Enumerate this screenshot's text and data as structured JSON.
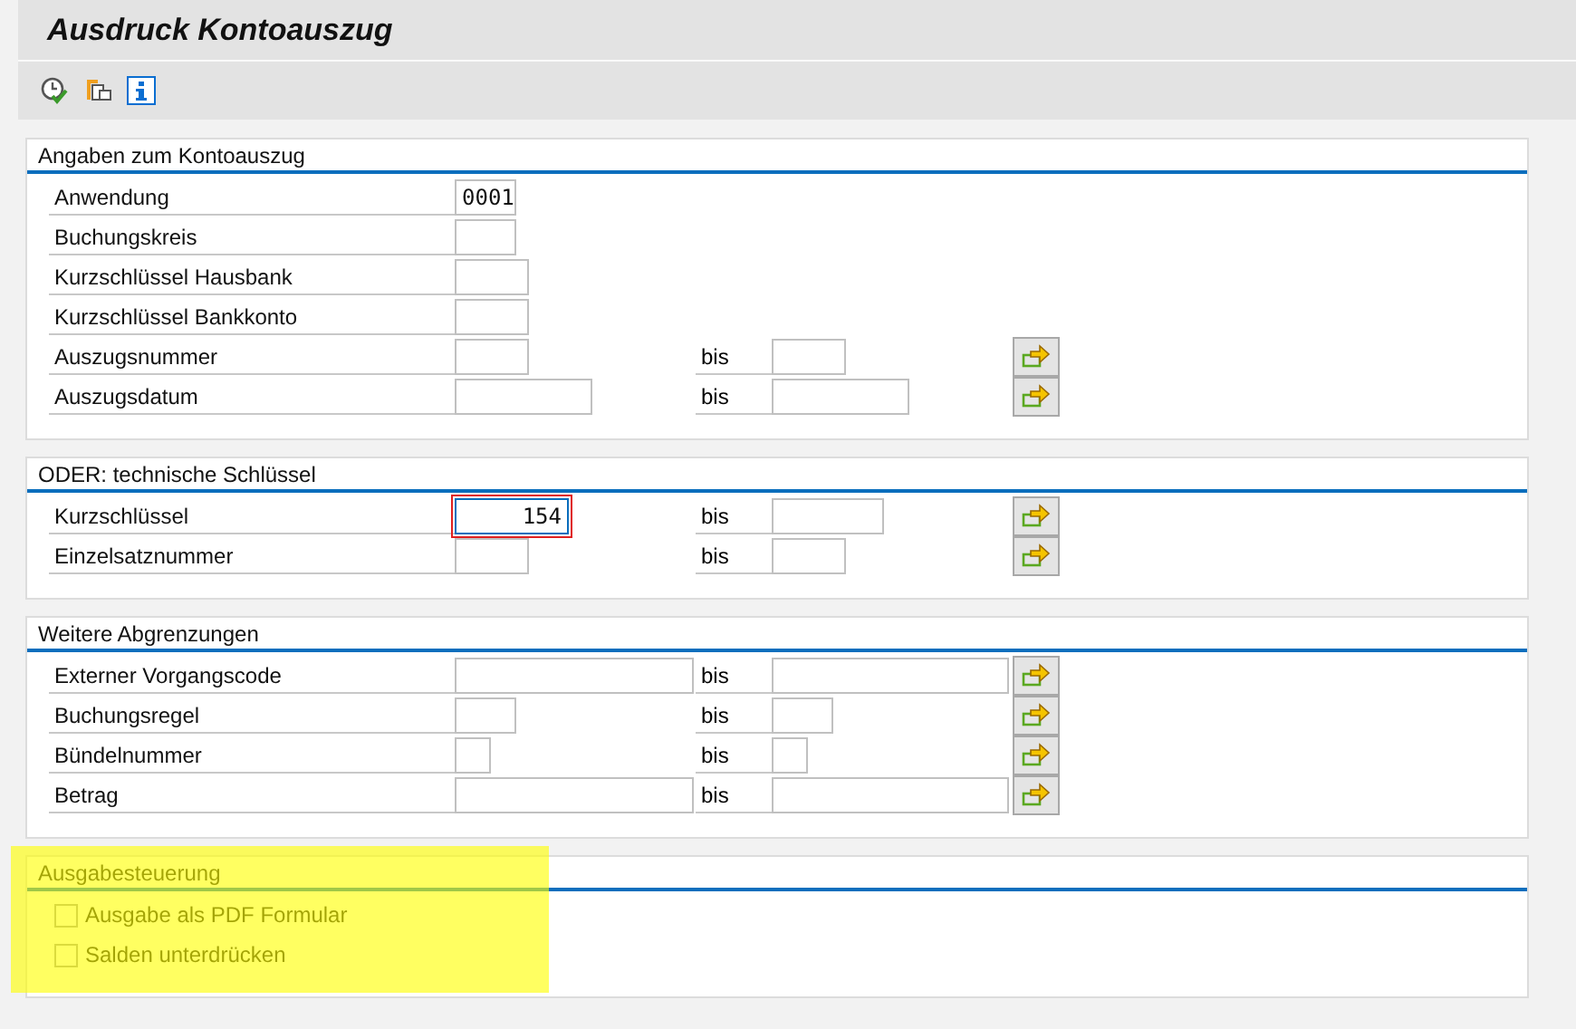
{
  "window": {
    "title": "Ausdruck Kontoauszug"
  },
  "toolbar": {
    "buttons": [
      {
        "kind": "execute"
      },
      {
        "kind": "variants"
      },
      {
        "kind": "info"
      }
    ]
  },
  "groups": [
    {
      "title": "Angaben zum Kontoauszug",
      "highlighted": false,
      "rows": [
        {
          "kind": "single",
          "label": "Anwendung",
          "field": {
            "value": "0001",
            "focused": false
          }
        },
        {
          "kind": "single",
          "label": "Buchungskreis",
          "field": {
            "focused": false
          }
        },
        {
          "kind": "single",
          "label": "Kurzschlüssel Hausbank",
          "field": {
            "focused": false
          }
        },
        {
          "kind": "single",
          "label": "Kurzschlüssel Bankkonto",
          "field": {
            "focused": false
          }
        },
        {
          "kind": "range",
          "label": "Auszugsnummer",
          "field": {
            "focused": false
          },
          "to_label": "bis"
        },
        {
          "kind": "range",
          "label": "Auszugsdatum",
          "field": {
            "focused": false
          },
          "to_label": "bis"
        }
      ]
    },
    {
      "title": "ODER: technische Schlüssel",
      "highlighted": false,
      "rows": [
        {
          "kind": "range",
          "label": "Kurzschlüssel",
          "field": {
            "value": "154",
            "focused": true
          },
          "to_label": "bis"
        },
        {
          "kind": "range",
          "label": "Einzelsatznummer",
          "field": {
            "focused": false
          },
          "to_label": "bis"
        }
      ]
    },
    {
      "title": "Weitere Abgrenzungen",
      "highlighted": false,
      "rows": [
        {
          "kind": "range",
          "label": "Externer Vorgangscode",
          "field": {
            "focused": false
          },
          "to_label": "bis"
        },
        {
          "kind": "range",
          "label": "Buchungsregel",
          "field": {
            "focused": false
          },
          "to_label": "bis"
        },
        {
          "kind": "range",
          "label": "Bündelnummer",
          "field": {
            "focused": false
          },
          "to_label": "bis"
        },
        {
          "kind": "range",
          "label": "Betrag",
          "field": {
            "focused": false
          },
          "to_label": "bis"
        }
      ]
    },
    {
      "title": "Ausgabesteuerung",
      "highlighted": true,
      "rows": [
        {
          "kind": "checkbox",
          "label": "Ausgabe als PDF Formular",
          "checked": false
        },
        {
          "kind": "checkbox",
          "label": "Salden unterdrücken",
          "checked": false
        }
      ]
    }
  ]
}
